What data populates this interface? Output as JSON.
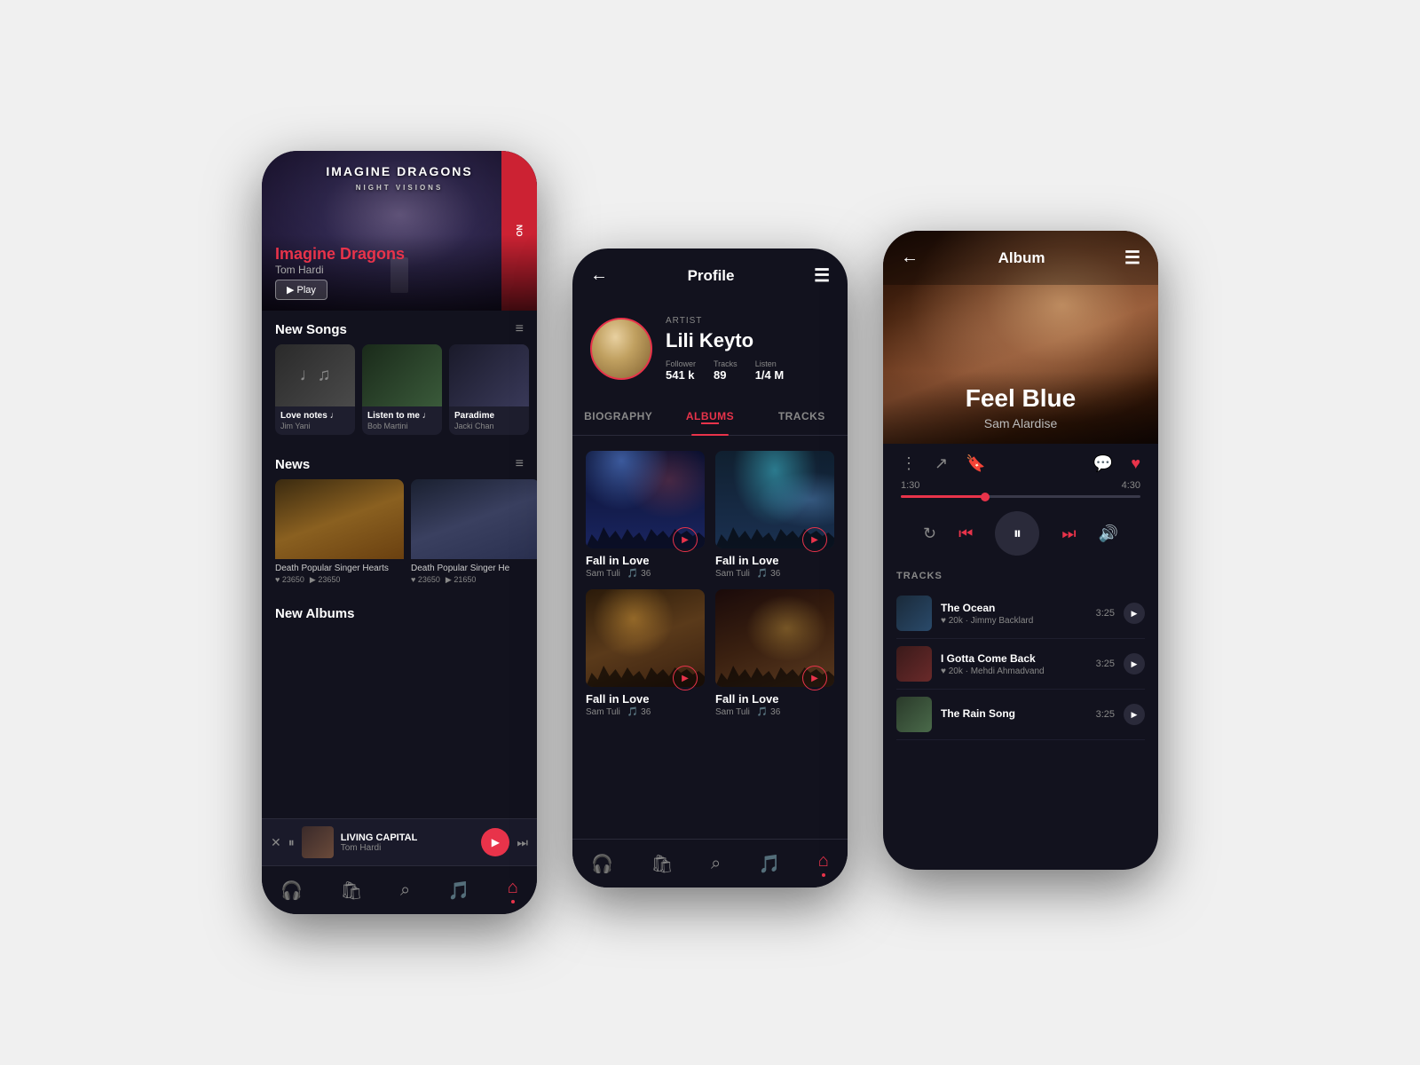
{
  "phone1": {
    "header": {
      "title": "Imagine Dragons",
      "subtitle": "Tom Hardi"
    },
    "banner": {
      "band_name": "IMAGINE DRAGONS",
      "album_name": "NIGHT VISIONS",
      "play_label": "▶ Play",
      "artist_label": "Imagine Dragons",
      "subtitle": "Tom Hardi"
    },
    "new_songs": {
      "title": "New Songs",
      "items": [
        {
          "name": "Love notes ♩",
          "artist": "Jim Yani"
        },
        {
          "name": "Listen to me ♩",
          "artist": "Bob Martini"
        },
        {
          "name": "Paradime",
          "artist": "Jacki Chan"
        }
      ]
    },
    "news": {
      "title": "News",
      "items": [
        {
          "label": "Death Popular Singer Hearts",
          "likes": "23650",
          "plays": "23650"
        },
        {
          "label": "Death Popular Singer He",
          "likes": "23650",
          "plays": "21650"
        }
      ]
    },
    "new_albums": {
      "title": "New Albums"
    },
    "player": {
      "title": "LIVING CAPITAL",
      "artist": "Tom Hardi"
    },
    "nav": [
      "🎧",
      "🛍",
      "⌕",
      "🎵",
      "⌂"
    ]
  },
  "phone2": {
    "header": {
      "title": "Profile",
      "back": "←",
      "menu": "☰"
    },
    "artist": {
      "label": "ARTIST",
      "name": "Lili Keyto",
      "stats": {
        "follower_label": "Follower",
        "follower_value": "541 k",
        "tracks_label": "Tracks",
        "tracks_value": "89",
        "listen_label": "Listen",
        "listen_value": "1/4 M"
      }
    },
    "tabs": [
      "BIOGRAPHY",
      "ALBUMS",
      "TRACKS"
    ],
    "active_tab": "ALBUMS",
    "albums": [
      {
        "name": "Fall in Love",
        "artist": "Sam Tuli",
        "tracks": "36",
        "style": "concert-dark-blue"
      },
      {
        "name": "Fall in Love",
        "artist": "Sam Tuli",
        "tracks": "36",
        "style": "concert-teal"
      },
      {
        "name": "Fall in Love",
        "artist": "Sam Tuli",
        "tracks": "36",
        "style": "concert-warm"
      },
      {
        "name": "Fall in Love",
        "artist": "Sam Tuli",
        "tracks": "36",
        "style": "guitar-dark"
      }
    ],
    "nav": [
      "🎧",
      "🛍",
      "⌕",
      "🎵",
      "⌂"
    ],
    "active_nav": 4
  },
  "phone3": {
    "header": {
      "title": "Album",
      "back": "←",
      "menu": "☰"
    },
    "now_playing": {
      "title": "Feel Blue",
      "artist": "Sam Alardise"
    },
    "progress": {
      "current": "1:30",
      "total": "4:30",
      "percent": 35
    },
    "tracks_section_title": "TRACKS",
    "tracks": [
      {
        "name": "The Ocean",
        "meta": "20k · Jimmy Backlard",
        "duration": "3:25"
      },
      {
        "name": "I Gotta Come Back",
        "meta": "20k · Mehdi Ahmadvand",
        "duration": "3:25"
      },
      {
        "name": "The Rain Song",
        "meta": "",
        "duration": "3:25"
      }
    ]
  }
}
